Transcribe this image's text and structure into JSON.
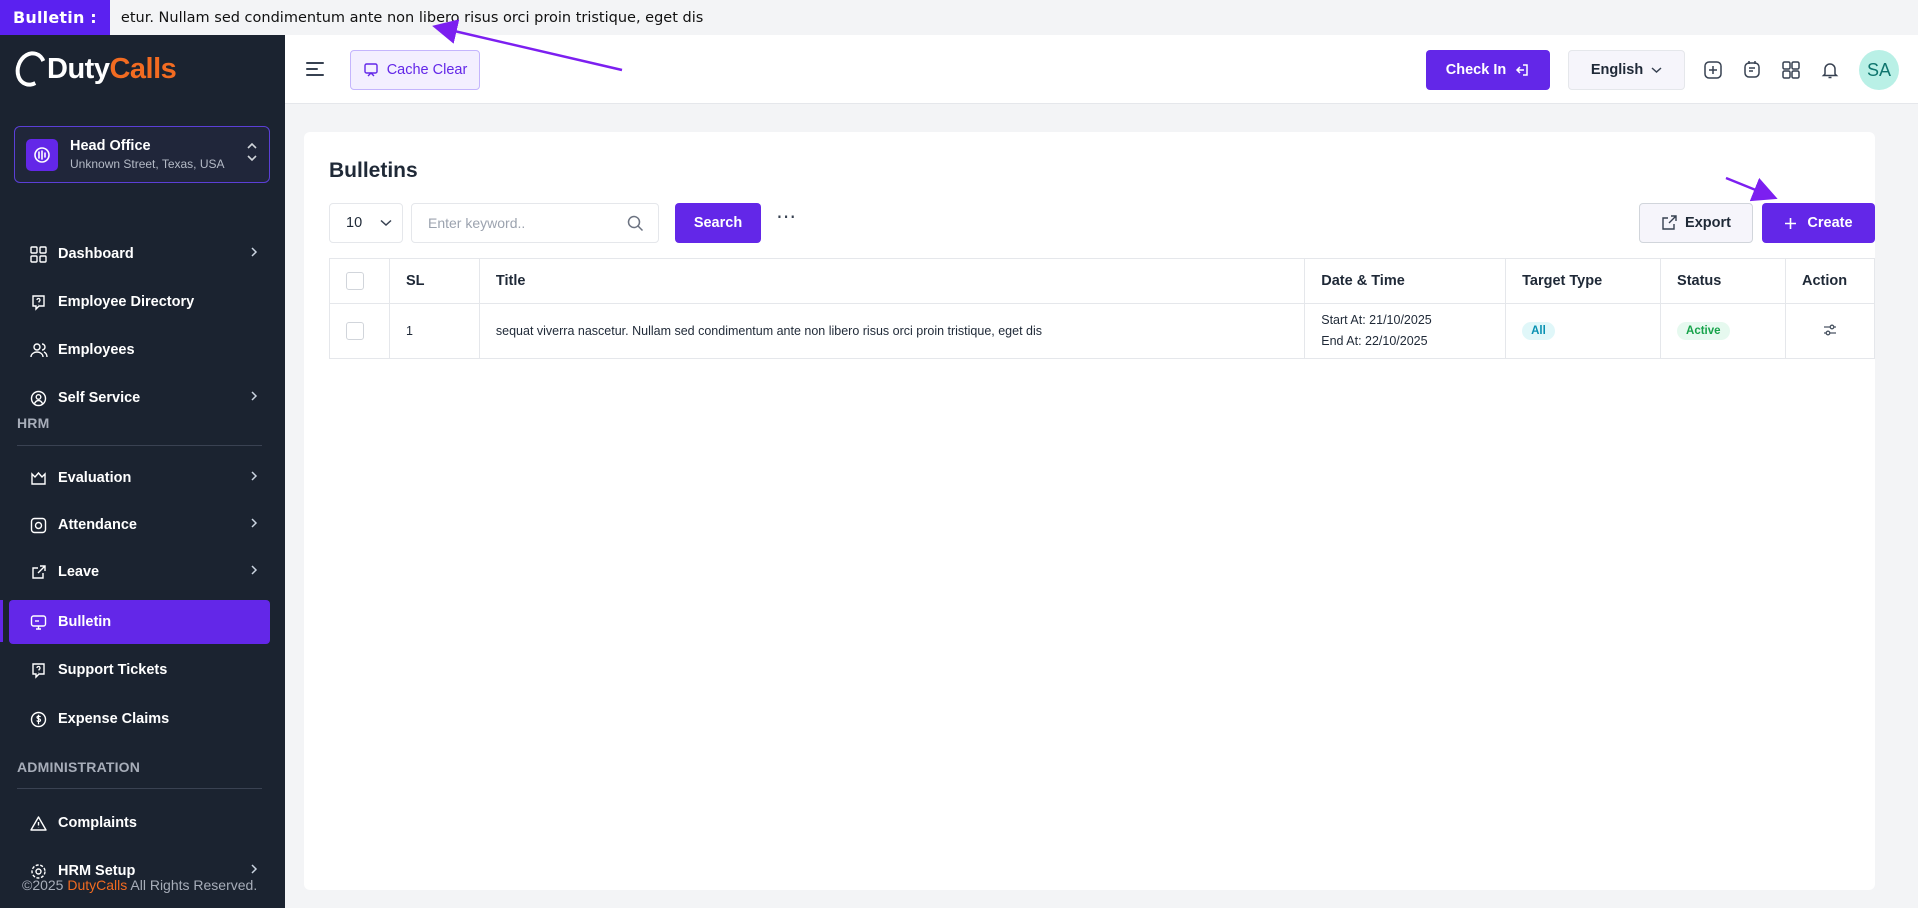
{
  "bulletin_bar": {
    "label": "Bulletin :",
    "text": "etur. Nullam sed condimentum ante non libero risus orci proin tristique, eget dis"
  },
  "sidebar": {
    "logo": {
      "duty": "Duty",
      "calls": "Calls"
    },
    "branch": {
      "name": "Head Office",
      "address": "Unknown Street, Texas, USA"
    },
    "items": [
      {
        "label": "Dashboard",
        "icon": "grid-icon",
        "has_arrow": true
      },
      {
        "label": "Employee Directory",
        "icon": "help-badge-icon",
        "has_arrow": false
      },
      {
        "label": "Employees",
        "icon": "users-icon",
        "has_arrow": false
      },
      {
        "label": "Self Service",
        "icon": "user-circle-icon",
        "has_arrow": true
      },
      {
        "label": "Evaluation",
        "icon": "crown-icon",
        "has_arrow": true
      },
      {
        "label": "Attendance",
        "icon": "target-icon",
        "has_arrow": true
      },
      {
        "label": "Leave",
        "icon": "external-link-icon",
        "has_arrow": true
      },
      {
        "label": "Bulletin",
        "icon": "monitor-icon",
        "has_arrow": false,
        "active": true
      },
      {
        "label": "Support Tickets",
        "icon": "ticket-icon",
        "has_arrow": false
      },
      {
        "label": "Expense Claims",
        "icon": "dollar-icon",
        "has_arrow": false
      },
      {
        "label": "Complaints",
        "icon": "warning-icon",
        "has_arrow": false
      },
      {
        "label": "HRM Setup",
        "icon": "settings-icon",
        "has_arrow": true
      }
    ],
    "sections": {
      "hrm": "HRM",
      "administration": "ADMINISTRATION"
    },
    "footer": {
      "prefix": "©2025 ",
      "brand": "DutyCalls",
      "suffix": " All Rights Reserved."
    }
  },
  "topbar": {
    "cache_clear": "Cache Clear",
    "check_in": "Check In",
    "language": "English",
    "avatar": "SA"
  },
  "main": {
    "title": "Bulletins",
    "per_page": "10",
    "search_placeholder": "Enter keyword..",
    "search_button": "Search",
    "more": "⋯",
    "export_button": "Export",
    "create_button": "Create",
    "table": {
      "headers": [
        "SL",
        "Title",
        "Date & Time",
        "Target Type",
        "Status",
        "Action"
      ],
      "rows": [
        {
          "sl": "1",
          "title": "sequat viverra nascetur. Nullam sed condimentum ante non libero risus orci proin tristique, eget dis",
          "start": "Start At: 21/10/2025",
          "end": "End At: 22/10/2025",
          "target": "All",
          "status": "Active"
        }
      ]
    }
  },
  "colors": {
    "accent": "#6327e8",
    "sidebar_bg": "#1b2330",
    "brand_orange": "#f26b21",
    "annotation_arrow": "#7c1ff0"
  }
}
